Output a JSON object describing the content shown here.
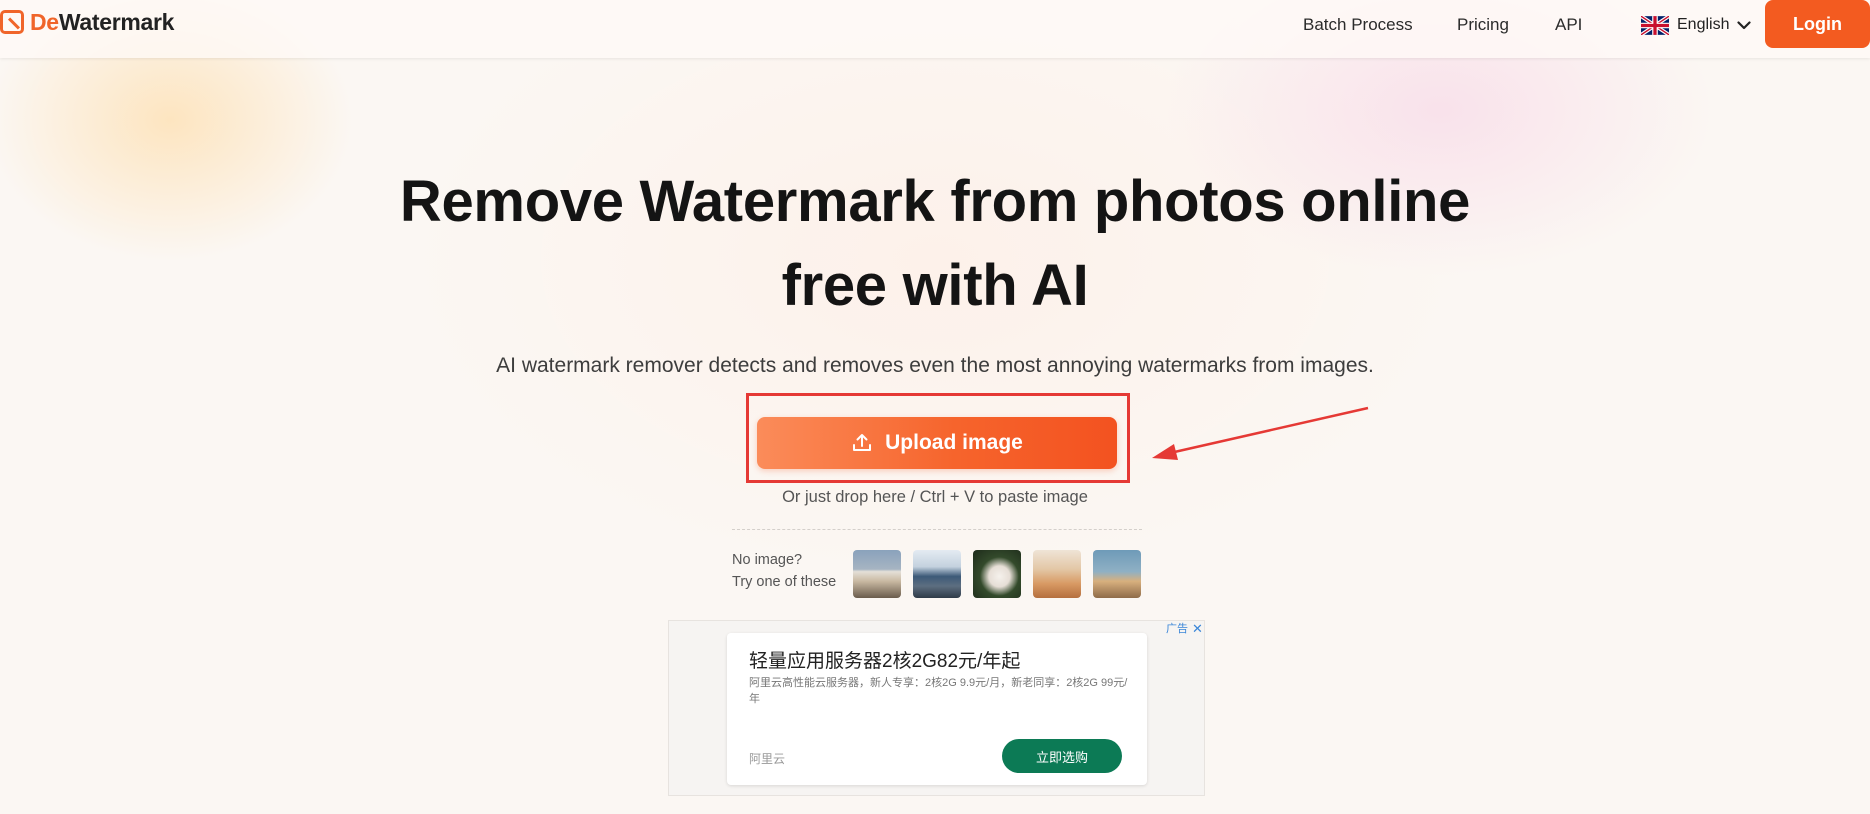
{
  "header": {
    "logo": {
      "prefix": "De",
      "suffix": "Watermark"
    },
    "nav": {
      "batch": "Batch Process",
      "pricing": "Pricing",
      "api": "API"
    },
    "language": {
      "label": "English",
      "flag_icon": "uk-flag-icon"
    },
    "login_label": "Login"
  },
  "hero": {
    "title_line1": "Remove Watermark from photos online",
    "title_line2": "free with AI",
    "subtitle": "AI watermark remover detects and removes even the most annoying watermarks from images."
  },
  "upload": {
    "button_label": "Upload image",
    "icon": "upload-icon",
    "drop_hint": "Or just drop here / Ctrl + V to paste image"
  },
  "samples": {
    "label_line1": "No image?",
    "label_line2": "Try one of these",
    "count": 5
  },
  "ad": {
    "tag": "广告",
    "close": "✕",
    "title": "轻量应用服务器2核2G82元/年起",
    "description": "阿里云高性能云服务器，新人专享：2核2G 9.9元/月，新老同享：2核2G 99元/年",
    "brand": "阿里云",
    "cta": "立即选购"
  },
  "colors": {
    "brand_orange": "#f35b20",
    "highlight_red": "#e53935",
    "ad_cta_green": "#0c7a55"
  }
}
